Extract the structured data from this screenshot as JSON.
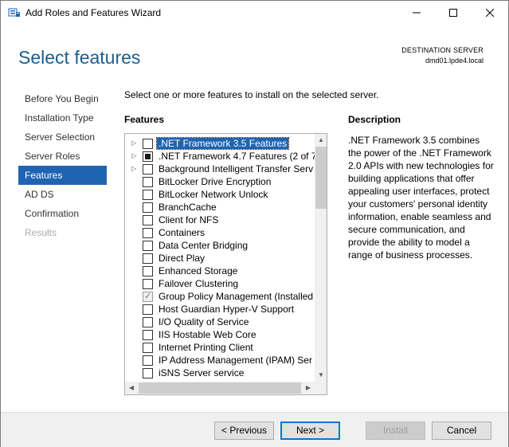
{
  "window": {
    "title": "Add Roles and Features Wizard",
    "minimize": "—",
    "maximize": "☐",
    "close": "✕"
  },
  "header": {
    "title": "Select features",
    "destination_label": "DESTINATION SERVER",
    "destination_value": "dmd01.lpde4.local"
  },
  "nav": {
    "items": [
      {
        "label": "Before You Begin",
        "state": "normal"
      },
      {
        "label": "Installation Type",
        "state": "normal"
      },
      {
        "label": "Server Selection",
        "state": "normal"
      },
      {
        "label": "Server Roles",
        "state": "normal"
      },
      {
        "label": "Features",
        "state": "active"
      },
      {
        "label": "AD DS",
        "state": "normal"
      },
      {
        "label": "Confirmation",
        "state": "normal"
      },
      {
        "label": "Results",
        "state": "disabled"
      }
    ]
  },
  "main": {
    "intro": "Select one or more features to install on the selected server.",
    "features_label": "Features",
    "description_label": "Description",
    "description_text": ".NET Framework 3.5 combines the power of the .NET Framework 2.0 APIs with new technologies for building applications that offer appealing user interfaces, protect your customers' personal identity information, enable seamless and secure communication, and provide the ability to model a range of business processes."
  },
  "features": [
    {
      "label": ".NET Framework 3.5 Features",
      "expandable": true,
      "check": "unchecked",
      "selected": true
    },
    {
      "label": ".NET Framework 4.7 Features (2 of 7",
      "expandable": true,
      "check": "partial",
      "selected": false
    },
    {
      "label": "Background Intelligent Transfer Serv",
      "expandable": true,
      "check": "unchecked",
      "selected": false
    },
    {
      "label": "BitLocker Drive Encryption",
      "expandable": false,
      "check": "unchecked",
      "selected": false
    },
    {
      "label": "BitLocker Network Unlock",
      "expandable": false,
      "check": "unchecked",
      "selected": false
    },
    {
      "label": "BranchCache",
      "expandable": false,
      "check": "unchecked",
      "selected": false
    },
    {
      "label": "Client for NFS",
      "expandable": false,
      "check": "unchecked",
      "selected": false
    },
    {
      "label": "Containers",
      "expandable": false,
      "check": "unchecked",
      "selected": false
    },
    {
      "label": "Data Center Bridging",
      "expandable": false,
      "check": "unchecked",
      "selected": false
    },
    {
      "label": "Direct Play",
      "expandable": false,
      "check": "unchecked",
      "selected": false
    },
    {
      "label": "Enhanced Storage",
      "expandable": false,
      "check": "unchecked",
      "selected": false
    },
    {
      "label": "Failover Clustering",
      "expandable": false,
      "check": "unchecked",
      "selected": false
    },
    {
      "label": "Group Policy Management (Installed",
      "expandable": false,
      "check": "checked-disabled",
      "selected": false
    },
    {
      "label": "Host Guardian Hyper-V Support",
      "expandable": false,
      "check": "unchecked",
      "selected": false
    },
    {
      "label": "I/O Quality of Service",
      "expandable": false,
      "check": "unchecked",
      "selected": false
    },
    {
      "label": "IIS Hostable Web Core",
      "expandable": false,
      "check": "unchecked",
      "selected": false
    },
    {
      "label": "Internet Printing Client",
      "expandable": false,
      "check": "unchecked",
      "selected": false
    },
    {
      "label": "IP Address Management (IPAM) Ser",
      "expandable": false,
      "check": "unchecked",
      "selected": false
    },
    {
      "label": "iSNS Server service",
      "expandable": false,
      "check": "unchecked",
      "selected": false
    }
  ],
  "footer": {
    "previous": "< Previous",
    "next": "Next >",
    "install": "Install",
    "cancel": "Cancel"
  },
  "colors": {
    "accent": "#1f64b2",
    "title": "#1e5d8c"
  }
}
